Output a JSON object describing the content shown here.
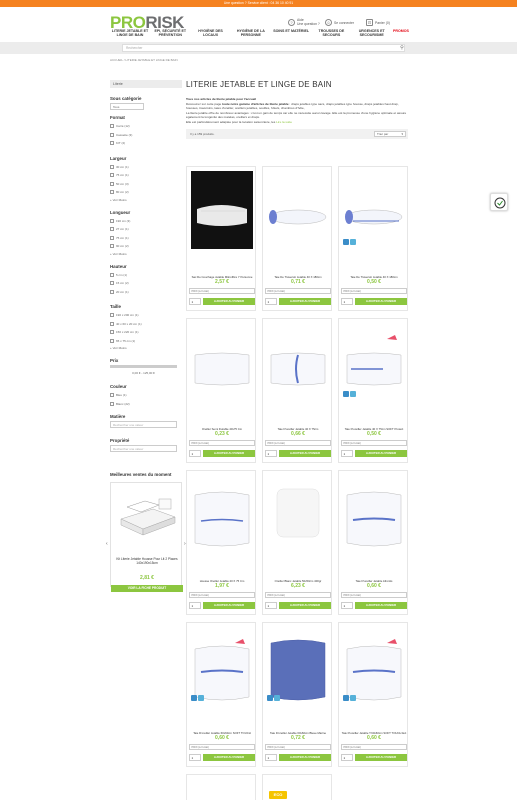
{
  "topbar": {
    "text": "Une question ? Service client : 04 36 10 40 91"
  },
  "header": {
    "logo_pro": "PRO",
    "logo_risk": "RISK",
    "help_label": "Aide",
    "help_sub": "Une question ?",
    "account_label": "Se connecter",
    "cart_label": "Panier (0)"
  },
  "nav": [
    {
      "label": "LITERIE JETABLE ET LINGE DE BAIN"
    },
    {
      "label": "EPI, SÉCURITÉ ET PRÉVENTION"
    },
    {
      "label": "HYGIÈNE DES LOCAUX"
    },
    {
      "label": "HYGIÈNE DE LA PERSONNE"
    },
    {
      "label": "SOINS ET MATÉRIEL"
    },
    {
      "label": "TROUSSES DE SECOURS"
    },
    {
      "label": "URGENCES ET SECOURISME"
    },
    {
      "label": "PROMOS"
    }
  ],
  "search": {
    "placeholder": "Rechercher"
  },
  "breadcrumb": "ACCUEIL  /  LITERIE JETABLE ET LINGE DE BAIN",
  "sidebar": {
    "category_box": "Literie",
    "sous_categorie": {
      "title": "Sous catégorie",
      "select": "Tous"
    },
    "format": {
      "title": "Format",
      "options": [
        "Carré (12)",
        "Cassette (3)",
        "KIT (2)"
      ]
    },
    "largeur": {
      "title": "Largeur",
      "options": [
        "30 cm (1)",
        "75 cm (1)",
        "50 cm (3)",
        "80 cm (2)"
      ],
      "more": "+ Voir Moins"
    },
    "longueur": {
      "title": "Longueur",
      "options": [
        "190 cm (3)",
        "27 cm (1)",
        "75 cm (1)",
        "90 cm (2)"
      ],
      "more": "+ Voir Moins"
    },
    "hauteur": {
      "title": "Hauteur",
      "options": [
        "5 cm (1)",
        "15 cm (2)",
        "20 cm (1)"
      ]
    },
    "taille": {
      "title": "Taille",
      "options": [
        "190 x 200 cm (1)",
        "40 x 60 x 20 cm (1)",
        "150 x 220 cm (1)",
        "65 x 75 cm (1)"
      ],
      "more": "+ Voir Moins"
    },
    "prix": {
      "title": "Prix",
      "range": "0,00 € - 125,00 €"
    },
    "couleur": {
      "title": "Couleur",
      "options": [
        "Bleu (1)",
        "Blanc (22)"
      ]
    },
    "matiere": {
      "title": "Matière",
      "placeholder": "Rechercher une valeur"
    },
    "propriete": {
      "title": "Propriété",
      "placeholder": "Rechercher une valeur"
    },
    "best": {
      "title": "Meilleures ventes du moment",
      "name": "Kit Literie Jetable Housse Pour Lit 2 Places 140x190x15cm",
      "price": "2,81 €",
      "button": "VOIR LA FICHE PRODUIT"
    }
  },
  "main": {
    "title": "LITERIE JETABLE ET LINGE DE BAIN",
    "intro_1": "Tous nos articles de literie jetable pour l'accueil",
    "intro_2a": "Découvrez sur cette page ",
    "intro_2b": "toute notre gamme d'articles de literie jetable",
    "intro_2c": " : draps jetables type sacs, draps jetables type housse, draps jetables haut drap, housses, traversins, taies d'oreiller, oreillers jetables, souillés, hôtels, chambres d'hôte, ",
    "intro_3": "La literie jetable offre de nombreux avantages : c'est un gain de temps car elle ne nécessite aucun lavage. Elle est la promesse d'une hygiène optimale et assure également la longévité des matelas, oreillers et draps.",
    "intro_4": "Elle est particulièrement adaptée pour la location saisonnière, les ",
    "intro_more": "Lire la suite",
    "count": "Il y a 159 produits.",
    "sort": "Trier par"
  },
  "product_common": {
    "unit": "PRIX (à l'unité)",
    "qty": "1",
    "add": "AJOUTER AU PANIER"
  },
  "products": [
    {
      "name": "Sac De Couchage Jetable Mikrofibre Y Personne",
      "price": "2,57 €"
    },
    {
      "name": "Taie De Traversin Jetable 40 X 180cm",
      "price": "0,71 €"
    },
    {
      "name": "Taie De Traversin Jetable 40 X 180cm",
      "price": "0,50 €"
    },
    {
      "name": "Oreiller Semi Durable 40x75 Cm",
      "price": "0,23 €"
    },
    {
      "name": "Taie D'oreiller Jetable 40 X 75cm",
      "price": "0,66 €"
    },
    {
      "name": "Taie D'oreiller Jetable 40 X 75cm SOFT Protect",
      "price": "0,50 €"
    },
    {
      "name": "Housse Oreiller Jetable 40 X 75 Cm",
      "price": "1,97 €"
    },
    {
      "name": "Oreiller Blanc Jetable 50x50cm 400gr",
      "price": "6,23 €"
    },
    {
      "name": "Taie D'oreiller Jetable Afrontis",
      "price": "0,60 €"
    },
    {
      "name": "Taie D'oreiller Jetable 60x60cm SOFT TOUCH",
      "price": "0,60 €"
    },
    {
      "name": "Taie D'oreiller Jetable 60x60cm Bleue Marine",
      "price": "0,72 €"
    },
    {
      "name": "Taie D'oreiller Jetable T.60x60cm SOFT TOUCH Ext",
      "price": "0,60 €"
    }
  ],
  "eco_label": "ECO"
}
